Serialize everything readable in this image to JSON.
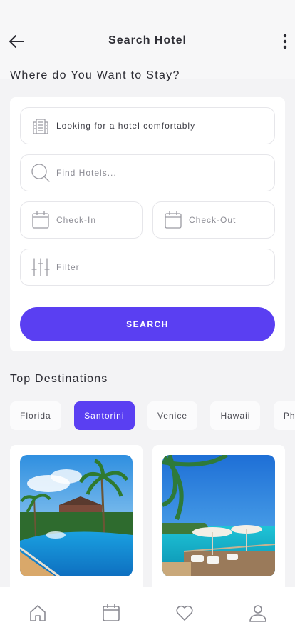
{
  "header": {
    "title": "Search Hotel"
  },
  "question": "Where do You Want to Stay?",
  "form": {
    "hotel_type": {
      "value": "Looking for a hotel comfortably",
      "icon": "hotel-building-icon"
    },
    "find": {
      "placeholder": "Find Hotels...",
      "icon": "search-icon"
    },
    "check_in": {
      "placeholder": "Check-In",
      "icon": "calendar-icon"
    },
    "check_out": {
      "placeholder": "Check-Out",
      "icon": "calendar-icon"
    },
    "filter": {
      "placeholder": "Filter",
      "icon": "sliders-icon"
    },
    "search_label": "SEARCH"
  },
  "destinations": {
    "title": "Top Destinations",
    "chips": [
      "Florida",
      "Santorini",
      "Venice",
      "Hawaii",
      "Phu"
    ],
    "active": "Santorini"
  },
  "colors": {
    "accent": "#5a3ff2",
    "background": "#f3f3f5",
    "card": "#ffffff"
  },
  "tabs": [
    "home-icon",
    "calendar-icon",
    "heart-icon",
    "profile-icon"
  ]
}
